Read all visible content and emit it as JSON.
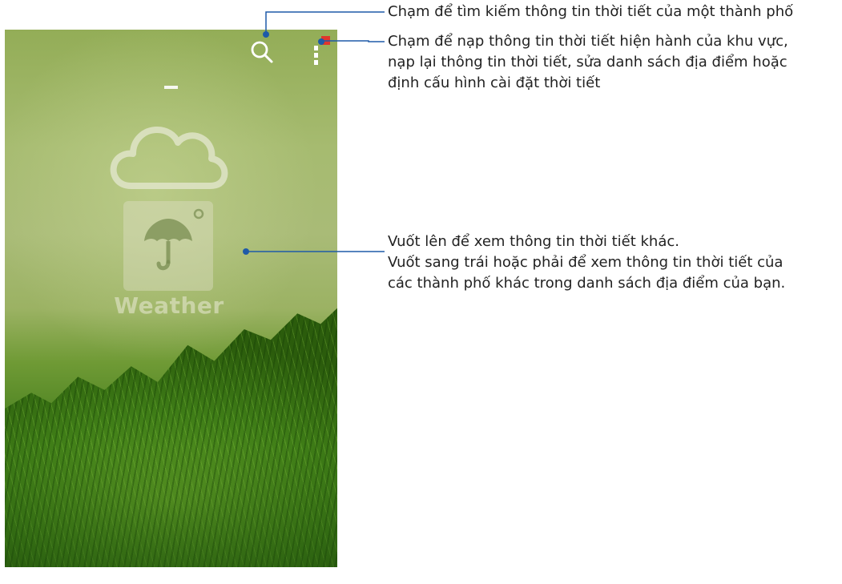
{
  "app": {
    "name": "Weather",
    "badge": ""
  },
  "icons": {
    "search": "search-icon",
    "menu": "more-vertical-icon",
    "cloud": "cloud-icon",
    "umbrella": "umbrella-icon"
  },
  "callouts": {
    "search": "Chạm để tìm kiếm thông tin thời tiết của một thành phố",
    "menu_line1": "Chạm để nạp thông tin thời tiết hiện hành của khu vực,",
    "menu_line2": "nạp lại thông tin thời tiết, sửa danh sách địa điểm hoặc",
    "menu_line3": "định cấu hình cài đặt thời tiết",
    "swipe_line1": "Vuốt lên để xem thông tin thời tiết khác.",
    "swipe_line2": "Vuốt sang trái hoặc phải để xem thông tin thời tiết của",
    "swipe_line3": "các thành phố khác trong danh sách địa điểm của bạn."
  },
  "colors": {
    "callout_line": "#1e5aa8",
    "badge": "#e0362c"
  }
}
